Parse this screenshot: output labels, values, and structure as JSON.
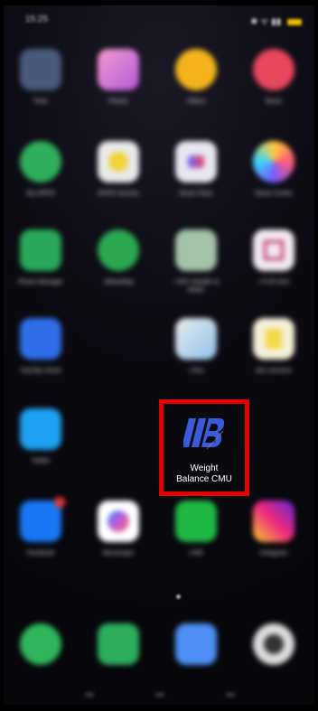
{
  "status_bar": {
    "time": "15:25",
    "indicators": "✱ ᯤ ▮▮"
  },
  "featured_app": {
    "label": "Weight\nBalance CMU",
    "highlight_color": "#e10000"
  },
  "apps": [
    {
      "label": "Tools",
      "color": "#4a5a7a"
    },
    {
      "label": "Photos",
      "color": "#d85aa8"
    },
    {
      "label": "Videos",
      "color": "#f3b41b"
    },
    {
      "label": "Music",
      "color": "#e8475e"
    },
    {
      "label": "My OPPO",
      "color": "#2fae5b"
    },
    {
      "label": "OPPO Service",
      "color": "#f1d23a"
    },
    {
      "label": "Music Party",
      "color": "#e7e7f2"
    },
    {
      "label": "Game Center",
      "color": "#ececf4"
    },
    {
      "label": "Phone Manager",
      "color": "#28a85a"
    },
    {
      "label": "UBoarding",
      "color": "#2aa84f"
    },
    {
      "label": "• NFC Reader & Writer",
      "color": "#a4c3a7"
    },
    {
      "label": "• FLIR One",
      "color": "#f0eaf0"
    },
    {
      "label": "HeyTap Cloud",
      "color": "#2f6ee8"
    },
    {
      "label": "• Aiss",
      "color": "#eaeaea"
    },
    {
      "label": "aiss services",
      "color": "#f3da45"
    },
    {
      "label": "Twitter",
      "color": "#1da1f2"
    },
    {
      "label": "Facebook",
      "color": "#1877f2"
    },
    {
      "label": "Messenger",
      "color": "#c05ad8"
    },
    {
      "label": "LINE",
      "color": "#20b845"
    },
    {
      "label": "Instagram",
      "color": "#e1306c"
    }
  ],
  "dock": [
    {
      "name": "phone",
      "color": "#2fb55b"
    },
    {
      "name": "messages",
      "color": "#2cae5d"
    },
    {
      "name": "browser",
      "color": "#4d8ff2"
    },
    {
      "name": "camera",
      "color": "#dcdcdc"
    }
  ]
}
